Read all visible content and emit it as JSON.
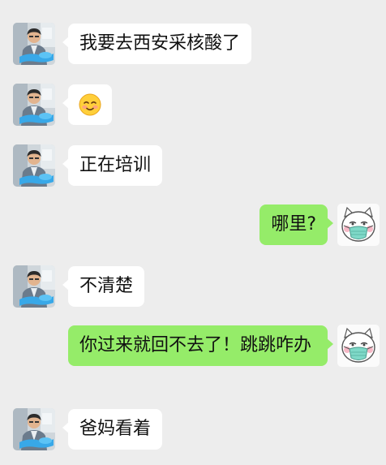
{
  "messages": [
    {
      "side": "left",
      "text": "我要去西安采核酸了"
    },
    {
      "side": "left",
      "type": "emoji",
      "emoji": "smiling-face-icon"
    },
    {
      "side": "left",
      "text": "正在培训"
    },
    {
      "side": "right",
      "text": "哪里?"
    },
    {
      "side": "left",
      "text": "不清楚"
    },
    {
      "side": "right",
      "text": "你过来就回不去了！跳跳咋办"
    },
    {
      "side": "left",
      "text": "爸妈看着"
    }
  ],
  "colors": {
    "background": "#ededed",
    "incoming_bubble": "#ffffff",
    "outgoing_bubble": "#95ec69",
    "text": "#111111"
  }
}
